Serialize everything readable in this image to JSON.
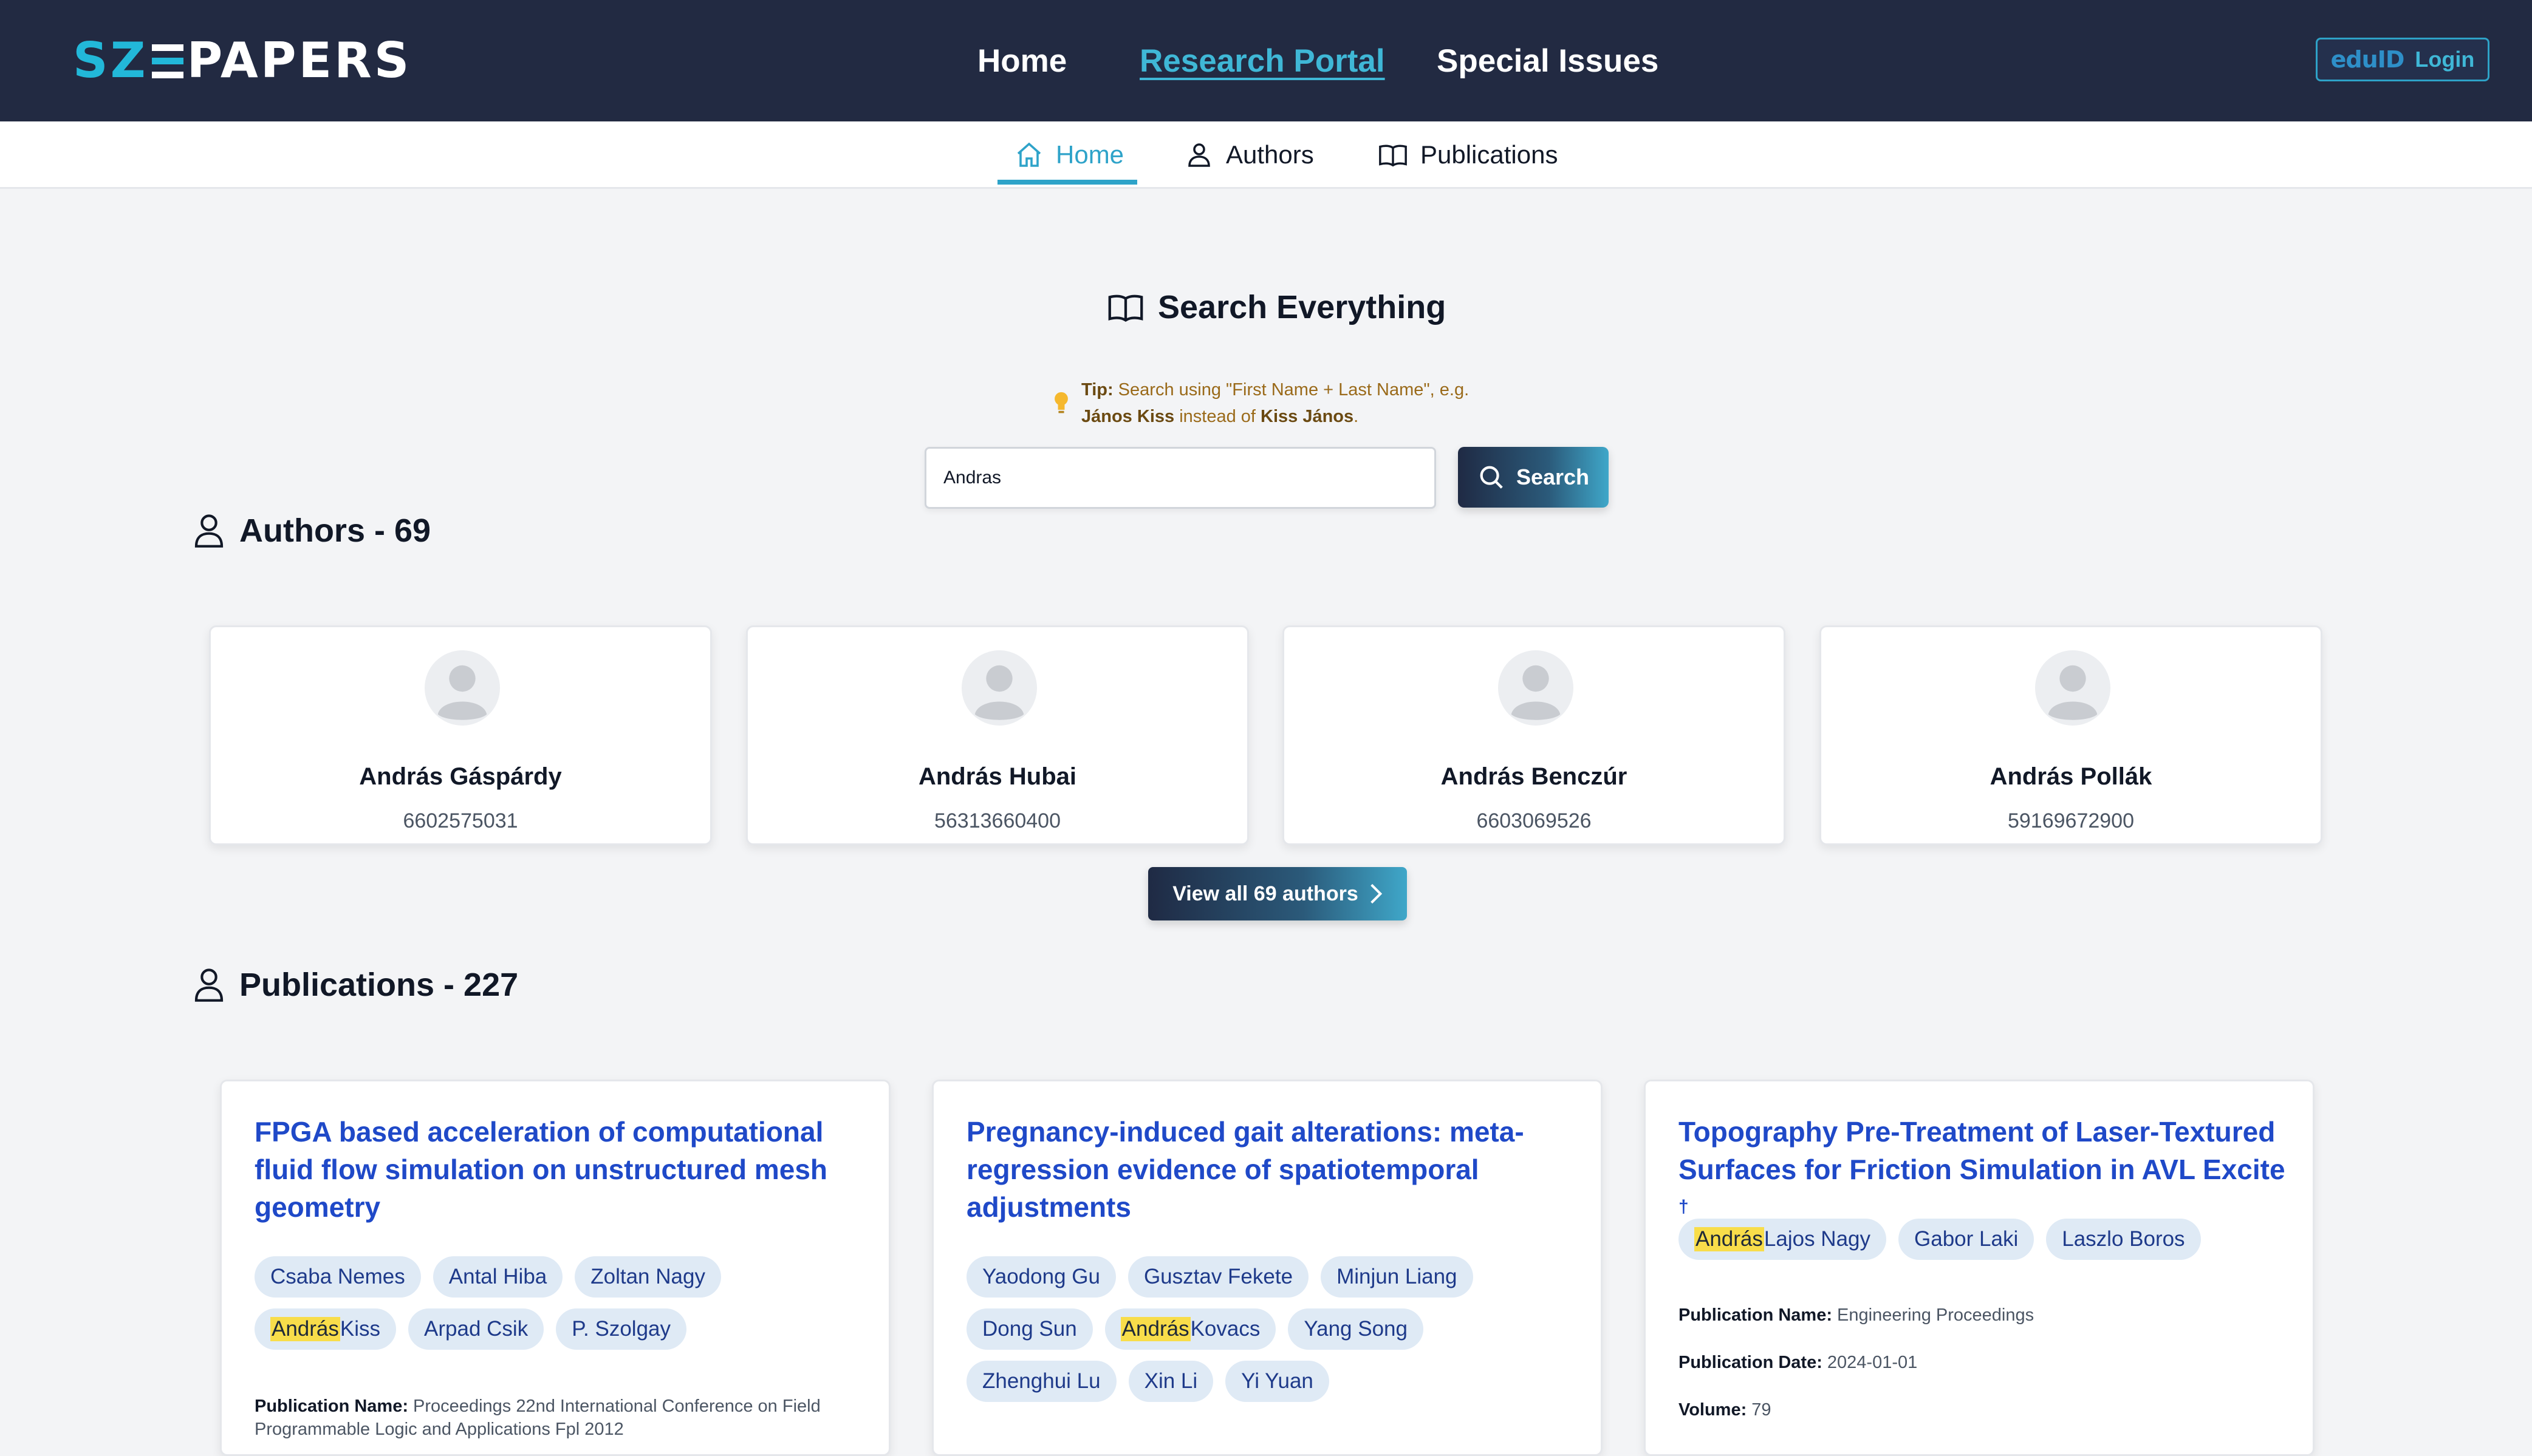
{
  "header": {
    "logo_left": "SZ",
    "logo_right": "PAPERS",
    "nav": [
      "Home",
      "Research Portal",
      "Special Issues"
    ],
    "login": {
      "badge": "eduID",
      "label": "Login"
    }
  },
  "subnav": {
    "tabs": [
      "Home",
      "Authors",
      "Publications"
    ],
    "active": "Home"
  },
  "search": {
    "title": "Search Everything",
    "tip_label": "Tip:",
    "tip_text": " Search using \"First Name + Last Name\", e.g.",
    "tip_example_correct": "János Kiss",
    "tip_mid": " instead of ",
    "tip_example_wrong": "Kiss János",
    "tip_end": ".",
    "query": "Andras",
    "button": "Search"
  },
  "authors": {
    "heading": "Authors - 69",
    "items": [
      {
        "name": "András Gáspárdy",
        "id": "6602575031"
      },
      {
        "name": "András Hubai",
        "id": "56313660400"
      },
      {
        "name": "András Benczúr",
        "id": "6603069526"
      },
      {
        "name": "András Pollák",
        "id": "59169672900"
      }
    ],
    "view_all": "View all 69 authors"
  },
  "publications": {
    "heading": "Publications - 227",
    "items": [
      {
        "title": "FPGA based acceleration of computational fluid flow simulation on unstructured mesh geometry",
        "authors": [
          {
            "pre": "",
            "hl": "",
            "post": "Csaba Nemes"
          },
          {
            "pre": "",
            "hl": "",
            "post": "Antal Hiba"
          },
          {
            "pre": "",
            "hl": "",
            "post": "Zoltan Nagy"
          },
          {
            "pre": "",
            "hl": "András",
            "post": " Kiss"
          },
          {
            "pre": "",
            "hl": "",
            "post": "Arpad Csik"
          },
          {
            "pre": "",
            "hl": "",
            "post": "P. Szolgay"
          }
        ],
        "meta": [
          {
            "label": "Publication Name:",
            "value": " Proceedings 22nd International Conference on Field Programmable Logic and Applications Fpl 2012"
          }
        ]
      },
      {
        "title": "Pregnancy-induced gait alterations: meta-regression evidence of spatiotemporal adjustments",
        "authors": [
          {
            "pre": "",
            "hl": "",
            "post": "Yaodong Gu"
          },
          {
            "pre": "",
            "hl": "",
            "post": "Gusztav Fekete"
          },
          {
            "pre": "",
            "hl": "",
            "post": "Minjun Liang"
          },
          {
            "pre": "",
            "hl": "",
            "post": "Dong Sun"
          },
          {
            "pre": "",
            "hl": "András",
            "post": " Kovacs"
          },
          {
            "pre": "",
            "hl": "",
            "post": "Yang Song"
          },
          {
            "pre": "",
            "hl": "",
            "post": "Zhenghui Lu"
          },
          {
            "pre": "",
            "hl": "",
            "post": "Xin Li"
          },
          {
            "pre": "",
            "hl": "",
            "post": "Yi Yuan"
          }
        ],
        "meta": []
      },
      {
        "title": "Topography Pre-Treatment of Laser-Textured Surfaces for Friction Simulation in AVL Excite",
        "title_mark": "†",
        "authors": [
          {
            "pre": "",
            "hl": "András",
            "post": " Lajos Nagy"
          },
          {
            "pre": "",
            "hl": "",
            "post": "Gabor Laki"
          },
          {
            "pre": "",
            "hl": "",
            "post": "Laszlo Boros"
          }
        ],
        "meta": [
          {
            "label": "Publication Name:",
            "value": " Engineering Proceedings"
          },
          {
            "label": "Publication Date:",
            "value": " 2024-01-01"
          },
          {
            "label": "Volume:",
            "value": " 79"
          }
        ]
      }
    ]
  },
  "colors": {
    "navbar": "#222a42",
    "accent": "#3fb7d6",
    "link": "#1f49c8",
    "chip": "#dfeaf5",
    "highlight": "#f8dd4a"
  },
  "icons": [
    "house-icon",
    "person-icon",
    "open-book-icon",
    "lightbulb-icon",
    "search-icon",
    "chevron-right-icon",
    "avatar-placeholder-icon"
  ]
}
